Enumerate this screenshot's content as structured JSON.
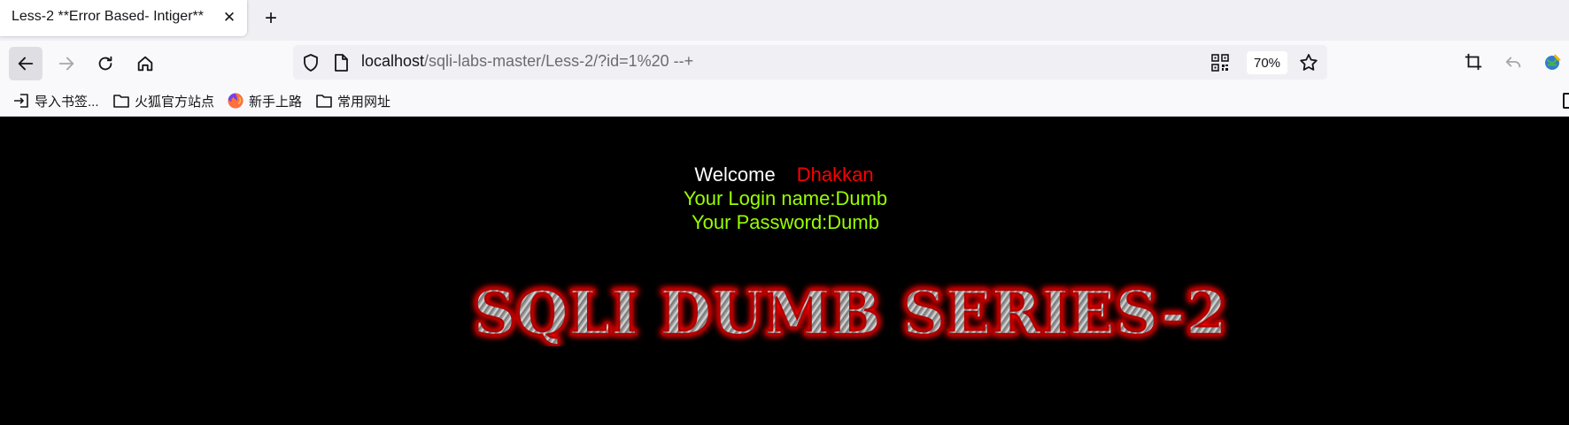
{
  "browser": {
    "tab": {
      "title": "Less-2 **Error Based- Intiger**"
    },
    "url": {
      "host": "localhost",
      "path": "/sqli-labs-master/Less-2/?id=1%20 --+"
    },
    "zoom": "70%",
    "bookmarks": [
      {
        "label": "导入书签...",
        "icon": "import-icon"
      },
      {
        "label": "火狐官方站点",
        "icon": "folder-icon"
      },
      {
        "label": "新手上路",
        "icon": "firefox-icon"
      },
      {
        "label": "常用网址",
        "icon": "folder-icon"
      }
    ]
  },
  "page": {
    "welcome": "Welcome",
    "user": "Dhakkan",
    "login_line": "Your Login name:Dumb",
    "password_line": "Your Password:Dumb",
    "banner": "SQLI DUMB SERIES-2",
    "colors": {
      "background": "#000000",
      "welcome": "#ffffff",
      "user": "#ff0000",
      "info": "#99ff00",
      "banner_glow": "#ff0000"
    }
  }
}
